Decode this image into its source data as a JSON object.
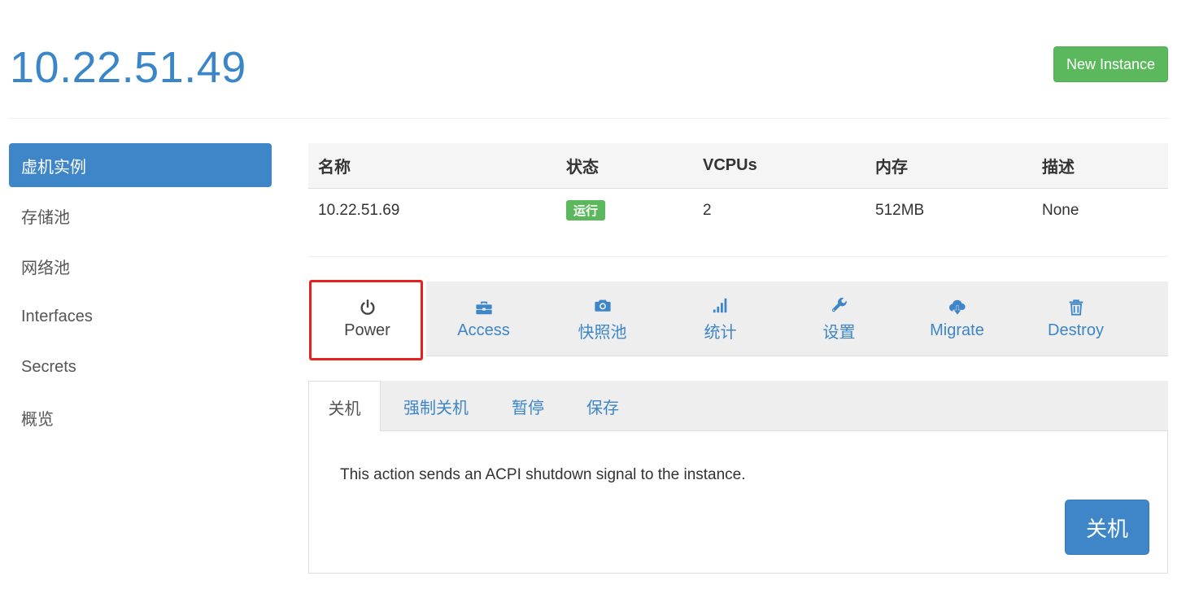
{
  "header": {
    "host_title": "10.22.51.49",
    "new_instance_label": "New Instance"
  },
  "sidebar": {
    "items": [
      {
        "label": "虚机实例",
        "active": true
      },
      {
        "label": "存储池"
      },
      {
        "label": "网络池"
      },
      {
        "label": "Interfaces"
      },
      {
        "label": "Secrets"
      },
      {
        "label": "概览"
      }
    ]
  },
  "instance_table": {
    "headers": [
      "名称",
      "状态",
      "VCPUs",
      "内存",
      "描述"
    ],
    "row": {
      "name": "10.22.51.69",
      "status": "运行",
      "vcpus": "2",
      "memory": "512MB",
      "description": "None"
    }
  },
  "actions": {
    "items": [
      {
        "label": "Power",
        "icon": "power-icon",
        "active": true
      },
      {
        "label": "Access",
        "icon": "briefcase-icon"
      },
      {
        "label": "快照池",
        "icon": "camera-icon"
      },
      {
        "label": "统计",
        "icon": "signal-icon"
      },
      {
        "label": "设置",
        "icon": "wrench-icon"
      },
      {
        "label": "Migrate",
        "icon": "cloud-download-icon"
      },
      {
        "label": "Destroy",
        "icon": "trash-icon"
      }
    ]
  },
  "power_tabs": {
    "items": [
      {
        "label": "关机",
        "active": true
      },
      {
        "label": "强制关机"
      },
      {
        "label": "暂停"
      },
      {
        "label": "保存"
      }
    ]
  },
  "panel": {
    "description": "This action sends an ACPI shutdown signal to the instance.",
    "button_label": "关机"
  },
  "colors": {
    "primary": "#3e86c7",
    "success": "#5cb85c",
    "highlight": "#e8201f"
  }
}
